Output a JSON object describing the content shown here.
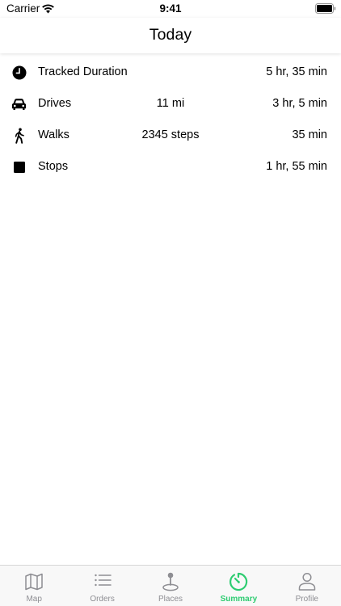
{
  "status_bar": {
    "carrier": "Carrier",
    "time": "9:41",
    "wifi_icon": "wifi-icon",
    "battery_icon": "battery-full-icon"
  },
  "nav": {
    "title": "Today"
  },
  "summary": {
    "rows": [
      {
        "icon": "clock-icon",
        "label": "Tracked Duration",
        "detail": "",
        "value": "5 hr, 35 min"
      },
      {
        "icon": "car-icon",
        "label": "Drives",
        "detail": "11 mi",
        "value": "3 hr, 5 min"
      },
      {
        "icon": "walking-person-icon",
        "label": "Walks",
        "detail": "2345 steps",
        "value": "35 min"
      },
      {
        "icon": "stop-square-icon",
        "label": "Stops",
        "detail": "",
        "value": "1 hr, 55 min"
      }
    ]
  },
  "tab_bar": {
    "active_color": "#2ecc71",
    "inactive_color": "#8e8e93",
    "tabs": [
      {
        "icon": "map-icon",
        "label": "Map",
        "active": false
      },
      {
        "icon": "list-icon",
        "label": "Orders",
        "active": false
      },
      {
        "icon": "map-pin-icon",
        "label": "Places",
        "active": false
      },
      {
        "icon": "summary-timer-icon",
        "label": "Summary",
        "active": true
      },
      {
        "icon": "person-icon",
        "label": "Profile",
        "active": false
      }
    ]
  }
}
